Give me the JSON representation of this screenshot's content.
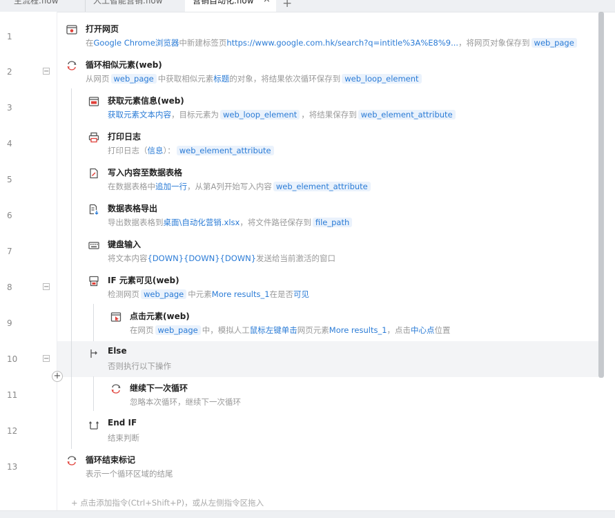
{
  "tabs": [
    {
      "label": "主流程.flow",
      "active": false
    },
    {
      "label": "人工智能营销.flow",
      "active": false
    },
    {
      "label": "营销自动化.flow",
      "active": true
    }
  ],
  "tab_close": "×",
  "tab_add": "+",
  "line_numbers": [
    "1",
    "2",
    "3",
    "4",
    "5",
    "6",
    "7",
    "8",
    "9",
    "10",
    "11",
    "12",
    "13"
  ],
  "steps": {
    "s1": {
      "title": "打开网页",
      "d1": "在",
      "d2": "Google Chrome浏览器",
      "d3": "中新建标签页",
      "d4": "https://www.google.com.hk/search?q=intitle%3A%E8%9...",
      "d5": "，将网页对象保存到",
      "chip1": "web_page"
    },
    "s2": {
      "title": "循环相似元素(web)",
      "d1": "从网页",
      "chip1": "web_page",
      "d2": "中获取相似元素",
      "d3": "标题",
      "d4": "的对象，将结果依次循环保存到",
      "chip2": "web_loop_element"
    },
    "s3": {
      "title": "获取元素信息(web)",
      "d1": "获取元素文本内容",
      "d2": "，目标元素为",
      "chip1": "web_loop_element",
      "d3": "，将结果保存到",
      "chip2": "web_element_attribute"
    },
    "s4": {
      "title": "打印日志",
      "d1": "打印日志（",
      "d2": "信息",
      "d3": "）：",
      "chip1": "web_element_attribute"
    },
    "s5": {
      "title": "写入内容至数据表格",
      "d1": "在数据表格中",
      "d2": "追加一行",
      "d3": "，从第A列开始写入内容",
      "chip1": "web_element_attribute"
    },
    "s6": {
      "title": "数据表格导出",
      "d1": "导出数据表格到",
      "d2": "桌面\\自动化营销.xlsx",
      "d3": "，将文件路径保存到",
      "chip1": "file_path"
    },
    "s7": {
      "title": "键盘输入",
      "d1": "将文本内容",
      "d2": "{DOWN}{DOWN}{DOWN}",
      "d3": "发送给当前激活的窗口"
    },
    "s8": {
      "title": "IF 元素可见(web)",
      "d1": "检测网页",
      "chip1": "web_page",
      "d2": "中元素",
      "d3": "More results_1",
      "d4": "在是否",
      "d5": "可见"
    },
    "s9": {
      "title": "点击元素(web)",
      "d1": "在网页",
      "chip1": "web_page",
      "d2": "中，模拟人工",
      "d3": "鼠标左键单击",
      "d4": "网页元素",
      "d5": "More results_1",
      "d6": "，点击",
      "d7": "中心点",
      "d8": "位置"
    },
    "s10": {
      "title": "Else",
      "d1": "否则执行以下操作"
    },
    "s11": {
      "title": "继续下一次循环",
      "d1": "忽略本次循环，继续下一次循环"
    },
    "s12": {
      "title": "End IF",
      "d1": "结束判断"
    },
    "s13": {
      "title": "循环结束标记",
      "d1": "表示一个循环区域的结尾"
    }
  },
  "bottom_hint": "+  点击添加指令(Ctrl+Shift+P)，或从左侧指令区拖入",
  "fold_symbol": "−",
  "add_symbol": "+",
  "colors": {
    "accent": "#2a7bd6",
    "chip_bg": "#eaf2fc",
    "icon_red": "#e0413a",
    "icon_gray": "#666666"
  }
}
